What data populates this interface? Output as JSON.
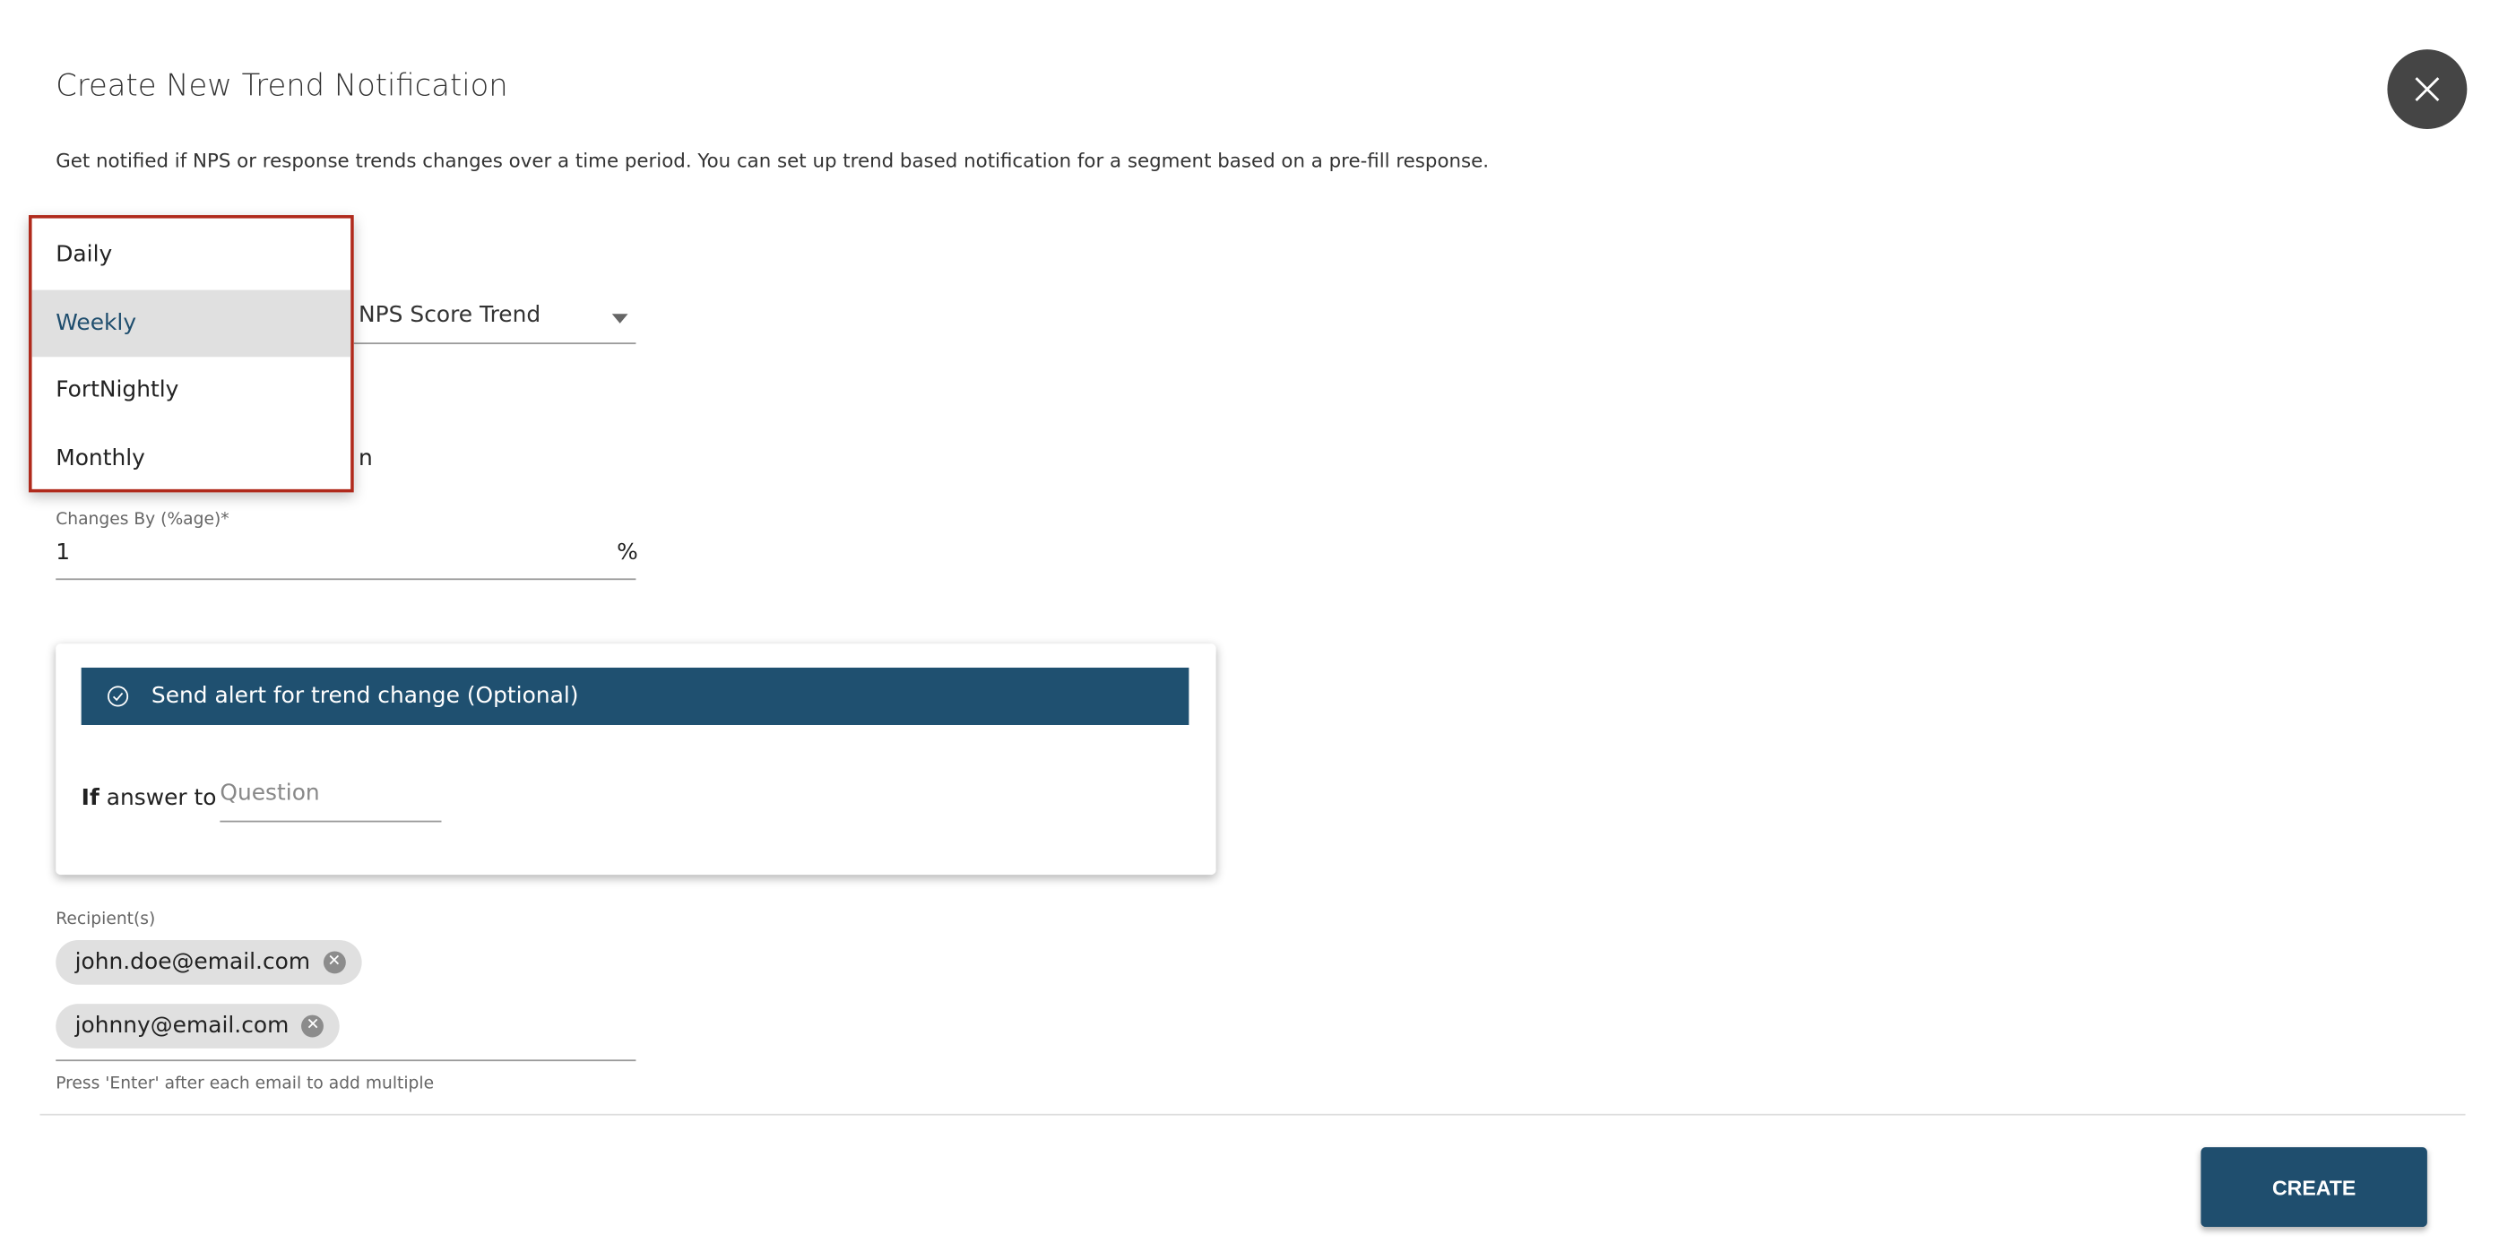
{
  "dialog": {
    "title": "Create New Trend Notification",
    "description": "Get notified if NPS or response trends changes over a time period. You can set up trend based notification for a segment based on a pre-fill response.",
    "close_icon": "close-icon"
  },
  "frequency_dropdown": {
    "options": [
      "Daily",
      "Weekly",
      "FortNightly",
      "Monthly"
    ],
    "highlighted": "Weekly",
    "border_color": "#b02a1c"
  },
  "trend_type": {
    "value": "NPS Score Trend"
  },
  "partial_text": "n",
  "changes_by": {
    "label": "Changes By (%age)*",
    "value": "1",
    "suffix": "%"
  },
  "alert_card": {
    "header": "Send alert for trend change (Optional)",
    "header_icon": "check-circle-icon",
    "if_label": "If",
    "answer_to_label": "answer to",
    "question_placeholder": "Question"
  },
  "recipients": {
    "label": "Recipient(s)",
    "chips": [
      "john.doe@email.com",
      "johnny@email.com"
    ],
    "help": "Press 'Enter' after each email to add multiple"
  },
  "footer": {
    "create_label": "CREATE"
  },
  "colors": {
    "primary": "#1f4e6e",
    "header": "#1f5070",
    "close_bg": "#454545"
  }
}
